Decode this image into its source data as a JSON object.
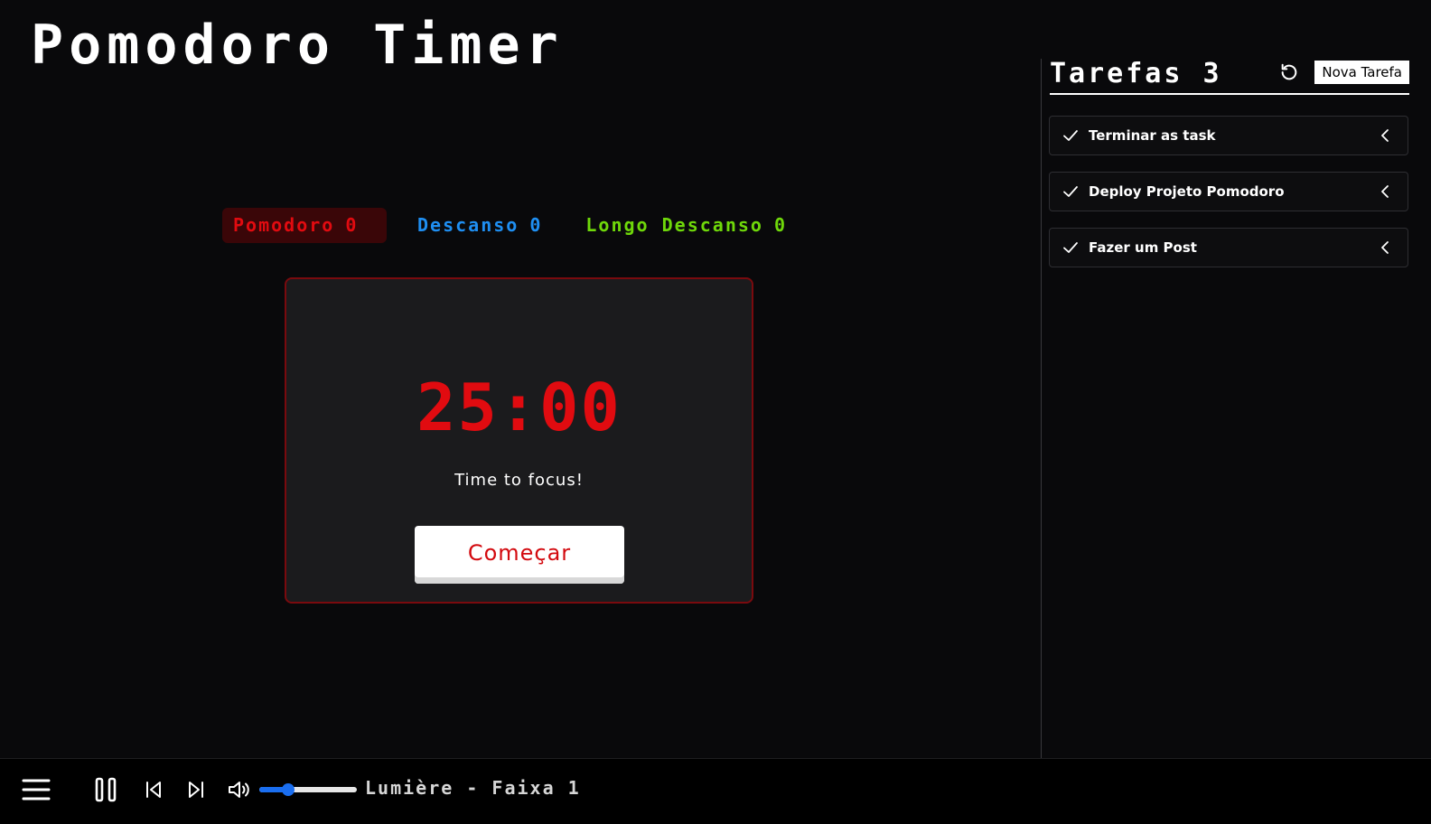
{
  "app": {
    "title": "Pomodoro Timer"
  },
  "modes": [
    {
      "label": "Pomodoro",
      "count": "0",
      "color": "#e10b10",
      "active": true
    },
    {
      "label": "Descanso",
      "count": "0",
      "color": "#1f8ff2",
      "active": false
    },
    {
      "label": "Longo Descanso",
      "count": "0",
      "color": "#6fd80a",
      "active": false
    }
  ],
  "timer": {
    "time": "25:00",
    "message": "Time to focus!",
    "start_label": "Começar",
    "accent": "#e10b10"
  },
  "tasks": {
    "title": "Tarefas",
    "count": "3",
    "reset_icon": "reset-icon",
    "new_task_label": "Nova Tarefa",
    "items": [
      {
        "label": "Terminar as task",
        "icon": "check-icon"
      },
      {
        "label": "Deploy Projeto Pomodoro",
        "icon": "check-icon"
      },
      {
        "label": "Fazer um Post",
        "icon": "check-icon"
      }
    ]
  },
  "player": {
    "track": "Lumière - Faixa 1",
    "volume": 0.3,
    "state": "playing",
    "icons": [
      "menu-icon",
      "pause-icon",
      "previous-icon",
      "next-icon",
      "volume-icon"
    ]
  }
}
